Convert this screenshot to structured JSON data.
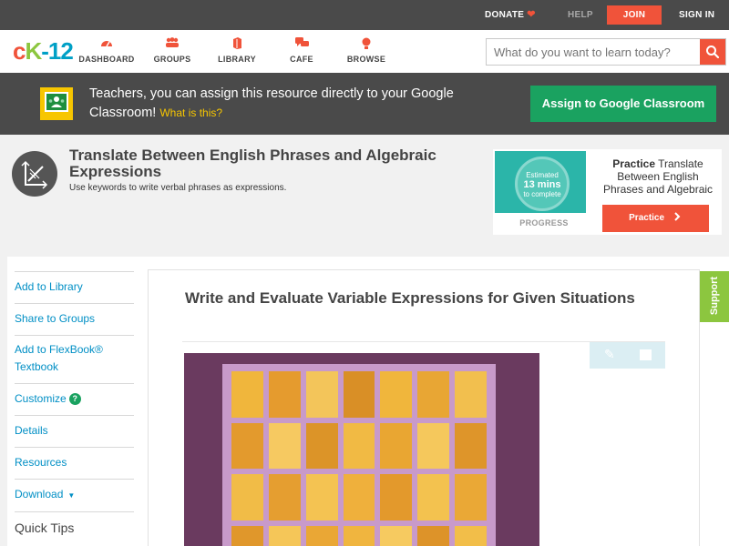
{
  "topbar": {
    "donate": "DONATE",
    "help": "HELP",
    "join": "JOIN",
    "signin": "SIGN IN"
  },
  "logo": {
    "c": "c",
    "k": "K",
    "num": "-12"
  },
  "nav": {
    "items": [
      {
        "label": "DASHBOARD",
        "icon": "dashboard-icon"
      },
      {
        "label": "GROUPS",
        "icon": "groups-icon"
      },
      {
        "label": "LIBRARY",
        "icon": "library-icon"
      },
      {
        "label": "CAFE",
        "icon": "cafe-icon"
      },
      {
        "label": "BROWSE",
        "icon": "browse-icon"
      }
    ],
    "search_placeholder": "What do you want to learn today?"
  },
  "classroom": {
    "text": "Teachers, you can assign this resource directly to your Google Classroom!",
    "what_link": "What is this?",
    "button": "Assign to Google Classroom"
  },
  "concept": {
    "title": "Translate Between English Phrases and Algebraic Expressions",
    "subtitle": "Use keywords to write verbal phrases as expressions."
  },
  "practice": {
    "estimate_label": "Estimated",
    "estimate_value": "13 mins",
    "estimate_suffix": "to complete",
    "progress": "PROGRESS",
    "heading_bold": "Practice",
    "heading_rest": "Translate Between English Phrases and Algebraic",
    "button": "Practice"
  },
  "sidebar": {
    "items": [
      {
        "label": "Add to Library"
      },
      {
        "label": "Share to Groups"
      },
      {
        "label": "Add to FlexBook® Textbook"
      },
      {
        "label": "Customize"
      },
      {
        "label": "Details"
      },
      {
        "label": "Resources"
      },
      {
        "label": "Download"
      }
    ],
    "customize_badge": "?",
    "quick_tips": "Quick Tips"
  },
  "main": {
    "title": "Write and Evaluate Variable Expressions for Given Situations"
  },
  "support": "Support",
  "colors": {
    "brand_orange": "#f0533a",
    "brand_green": "#8cc63f",
    "brand_blue": "#00a0c6",
    "link": "#008fc5",
    "classroom_green": "#1aa260"
  }
}
